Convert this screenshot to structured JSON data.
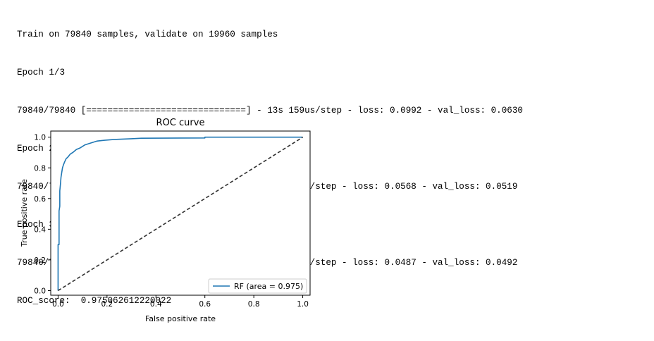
{
  "console": {
    "lines": [
      "Train on 79840 samples, validate on 19960 samples",
      "Epoch 1/3",
      "79840/79840 [==============================] - 13s 159us/step - loss: 0.0992 - val_loss: 0.0630",
      "Epoch 2/3",
      "79840/79840 [==============================] - 9s 117us/step - loss: 0.0568 - val_loss: 0.0519",
      "Epoch 3/3",
      "79840/79840 [==============================] - 8s 103us/step - loss: 0.0487 - val_loss: 0.0492",
      "ROC_score:  0.975062612220022"
    ]
  },
  "chart_data": {
    "type": "line",
    "title": "ROC curve",
    "xlabel": "False positive rate",
    "ylabel": "True positive rate",
    "xlim": [
      -0.03,
      1.03
    ],
    "ylim": [
      -0.03,
      1.04
    ],
    "xticks": [
      "0.0",
      "0.2",
      "0.4",
      "0.6",
      "0.8",
      "1.0"
    ],
    "yticks": [
      "0.0",
      "0.2",
      "0.4",
      "0.6",
      "0.8",
      "1.0"
    ],
    "grid": false,
    "legend_position": "lower-right",
    "series": [
      {
        "name": "RF (area = 0.975)",
        "color": "#1f77b4",
        "style": "solid",
        "x": [
          0.0,
          0.0,
          0.004,
          0.004,
          0.007,
          0.007,
          0.01,
          0.012,
          0.015,
          0.018,
          0.022,
          0.027,
          0.033,
          0.04,
          0.05,
          0.06,
          0.075,
          0.09,
          0.11,
          0.13,
          0.16,
          0.19,
          0.23,
          0.3,
          0.34,
          0.6,
          0.6,
          1.0
        ],
        "y": [
          0.0,
          0.3,
          0.3,
          0.52,
          0.55,
          0.65,
          0.7,
          0.74,
          0.77,
          0.8,
          0.82,
          0.84,
          0.86,
          0.87,
          0.89,
          0.9,
          0.92,
          0.93,
          0.95,
          0.96,
          0.975,
          0.98,
          0.985,
          0.99,
          0.993,
          0.995,
          1.0,
          1.0
        ]
      },
      {
        "name": "",
        "color": "#333333",
        "style": "dashed",
        "x": [
          0,
          1
        ],
        "y": [
          0,
          1
        ]
      }
    ]
  }
}
